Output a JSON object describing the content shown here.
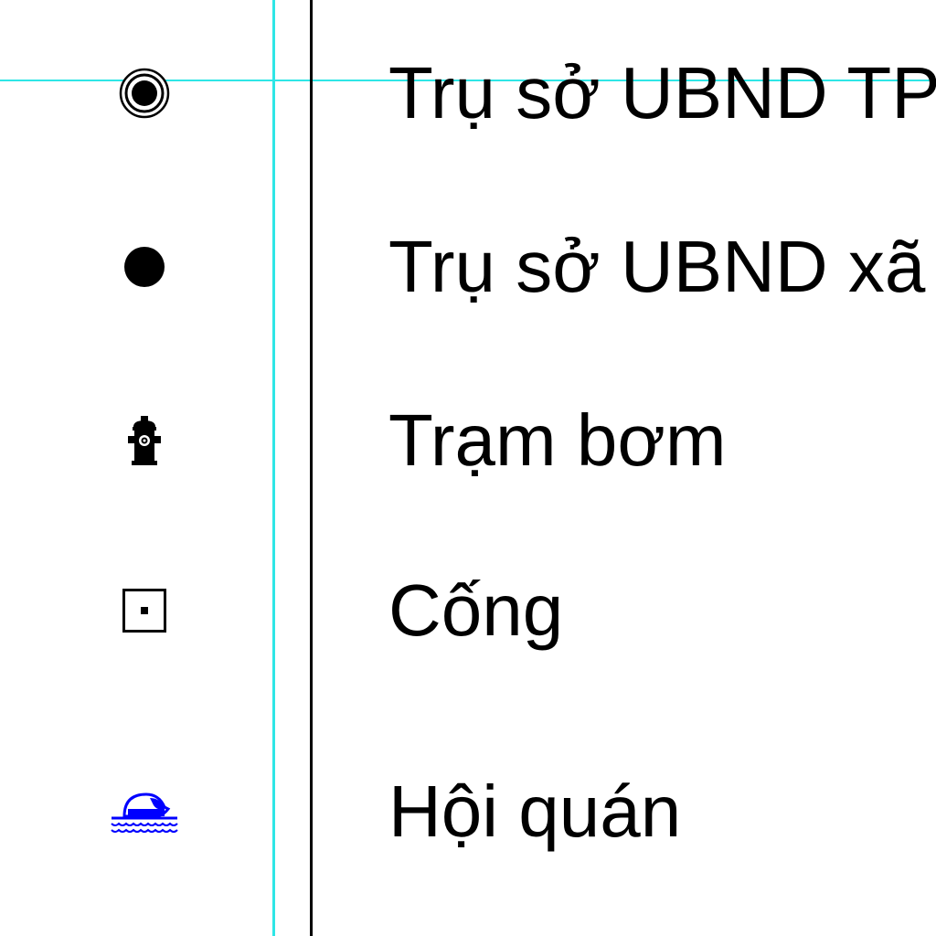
{
  "legend": {
    "items": [
      {
        "label": "Trụ sở UBND TP",
        "icon": "circled-dot-icon"
      },
      {
        "label": "Trụ sở UBND xã",
        "icon": "filled-circle-icon"
      },
      {
        "label": "Trạm bơm",
        "icon": "fire-hydrant-icon"
      },
      {
        "label": "Cống",
        "icon": "boxed-dot-icon"
      },
      {
        "label": "Hội quán",
        "icon": "dome-over-water-icon"
      }
    ]
  },
  "colors": {
    "guide_line": "#2ee6e6",
    "divider": "#000000",
    "symbol_black": "#000000",
    "symbol_blue": "#0000ff"
  }
}
